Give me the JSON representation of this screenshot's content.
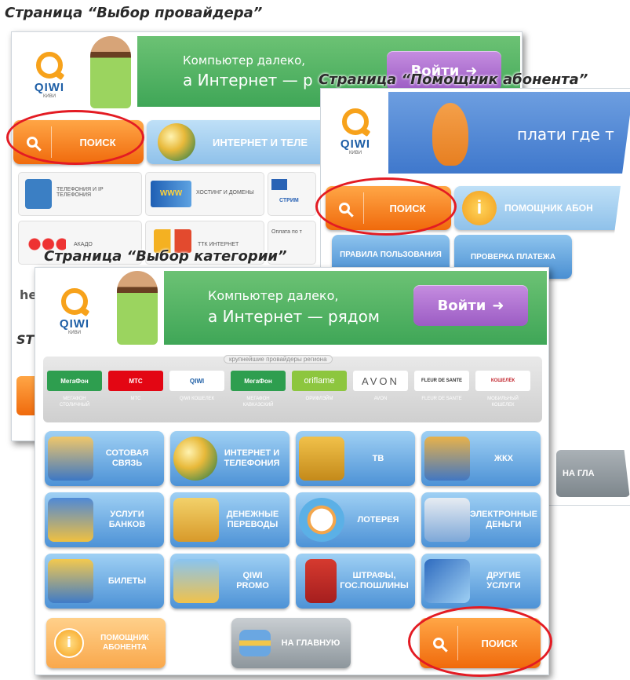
{
  "captions": {
    "provider": "Страница “Выбор провайдера”",
    "helper": "Страница “Помощник абонента”",
    "category": "Страница “Выбор категории”"
  },
  "logo": {
    "word": "QIWI",
    "sub": "КИВИ"
  },
  "banner": {
    "line1": "Компьютер далеко,",
    "line2": "а Интернет — рядом",
    "line2_cut": "а Интернет — р",
    "enter": "Войти"
  },
  "provider_page": {
    "search": "ПОИСК",
    "internet_tab": "ИНТЕРНЕТ И ТЕЛЕ",
    "tiles": [
      {
        "label": "ТЕЛЕФОНИЯ И IP ТЕЛЕФОНИЯ"
      },
      {
        "label": "ХОСТИНГ И ДОМЕНЫ"
      },
      {
        "label": "СТРИМ"
      },
      {
        "label": "АКАДО"
      },
      {
        "label": "ТТК ИНТЕРНЕТ"
      },
      {
        "label": "Оплата по т"
      }
    ],
    "side_frags": [
      "he",
      "ST"
    ]
  },
  "helper_page": {
    "slogan": "плати где т",
    "search": "ПОИСК",
    "helper_tab": "ПОМОЩНИК АБОН",
    "rules": "ПРАВИЛА ПОЛЬЗОВАНИЯ",
    "check": "ПРОВЕРКА ПЛАТЕЖА",
    "home_frag": "НА ГЛА"
  },
  "category_page": {
    "providers_title": "крупнейшие провайдеры региона",
    "providers": [
      {
        "logo": "МегаФон",
        "name": "МЕГАФОН\nСТОЛИЧНЫЙ",
        "color": "#2e9e4f"
      },
      {
        "logo": "МТС",
        "name": "МТС",
        "color": "#e30613"
      },
      {
        "logo": "QIWI",
        "name": "QIWI КОШЕЛЕК",
        "color": "#f7a21b"
      },
      {
        "logo": "МегаФон",
        "name": "МЕГАФОН\nКАВКАЗСКИЙ",
        "color": "#2e9e4f"
      },
      {
        "logo": "oriflame",
        "name": "ОРИФЛЭЙМ",
        "color": "#7fb93a"
      },
      {
        "logo": "AVON",
        "name": "AVON",
        "color": "#555555"
      },
      {
        "logo": "FLEUR DE SANTE",
        "name": "FLEUR DE SANTE",
        "color": "#333333"
      },
      {
        "logo": "КОШЕЛЁК",
        "name": "МОБИЛЬНЫЙ\nКОШЕЛЕК",
        "color": "#c2262e"
      }
    ],
    "categories": [
      {
        "label": "СОТОВАЯ\nСВЯЗЬ",
        "icon": "phone-icon"
      },
      {
        "label": "ИНТЕРНЕТ И\nТЕЛЕФОНИЯ",
        "icon": "globe-icon"
      },
      {
        "label": "ТВ",
        "icon": "tv-icon"
      },
      {
        "label": "ЖКХ",
        "icon": "house-icon"
      },
      {
        "label": "УСЛУГИ\nБАНКОВ",
        "icon": "safe-icon"
      },
      {
        "label": "ДЕНЕЖНЫЕ\nПЕРЕВОДЫ",
        "icon": "signpost-icon"
      },
      {
        "label": "ЛОТЕРЕЯ",
        "icon": "lottery-icon"
      },
      {
        "label": "ЭЛЕКТРОННЫЕ\nДЕНЬГИ",
        "icon": "mouse-icon"
      },
      {
        "label": "БИЛЕТЫ",
        "icon": "ticket-icon"
      },
      {
        "label": "QIWI\nPROMO",
        "icon": "stand-icon"
      },
      {
        "label": "ШТРАФЫ,\nГОС.ПОШЛИНЫ",
        "icon": "emblem-icon"
      },
      {
        "label": "ДРУГИЕ\nУСЛУГИ",
        "icon": "cubes-icon"
      }
    ],
    "helper_btn": "ПОМОЩНИК\nАБОНЕНТА",
    "home_btn": "НА ГЛАВНУЮ",
    "search": "ПОИСК"
  },
  "colors": {
    "accent_orange": "#f06a0c",
    "qiwi_blue": "#1d5ea6",
    "highlight_red": "#e31b23"
  }
}
